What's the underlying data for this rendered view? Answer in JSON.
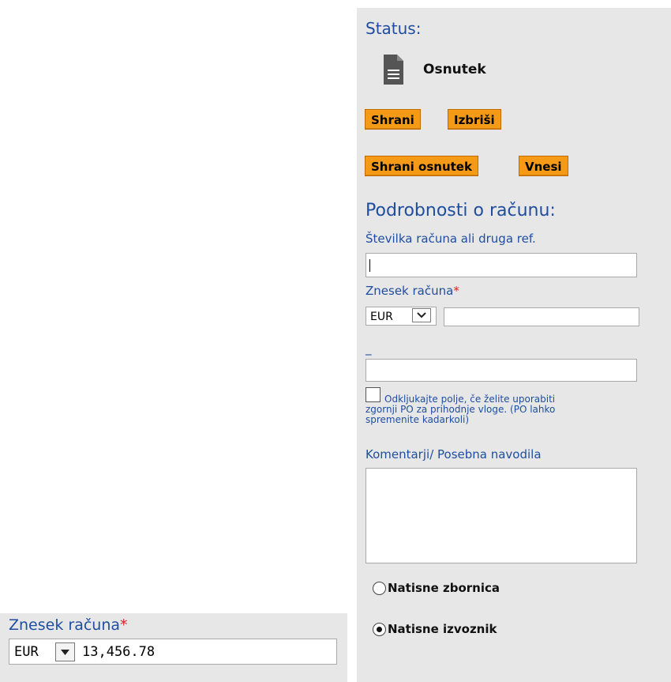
{
  "status": {
    "title": "Status:",
    "icon": "document-icon",
    "value": "Osnutek"
  },
  "buttons": {
    "save": "Shrani",
    "delete": "Izbriši",
    "save_draft": "Shrani osnutek",
    "submit": "Vnesi"
  },
  "details": {
    "title": "Podrobnosti o računu:",
    "invoice_ref_label": "Številka računa ali druga ref.",
    "invoice_ref_value": "",
    "amount_label": "Znesek računa",
    "required_mark": "*",
    "currency": "EUR",
    "amount_value": "",
    "po_label": "_",
    "po_value": "",
    "remember_po_checked": false,
    "remember_po_text_1": "Odkljukajte polje, če želite uporabiti",
    "remember_po_text_2": "zgornji PO za prihodnje vloge. (PO lahko",
    "remember_po_text_3": "spremenite kadarkoli)",
    "comments_label": "Komentarji/ Posebna navodila",
    "comments_value": ""
  },
  "print_options": [
    {
      "label": "Natisne zbornica",
      "selected": false
    },
    {
      "label": "Natisne izvoznik",
      "selected": true
    }
  ],
  "inset": {
    "amount_label": "Znesek računa",
    "required_mark": "*",
    "currency": "EUR",
    "amount_value": "13,456.78"
  },
  "colors": {
    "accent_button": "#f59a17",
    "label_blue": "#1f4ea1",
    "required_red": "#e02020",
    "panel_bg": "#e7e7e7"
  }
}
